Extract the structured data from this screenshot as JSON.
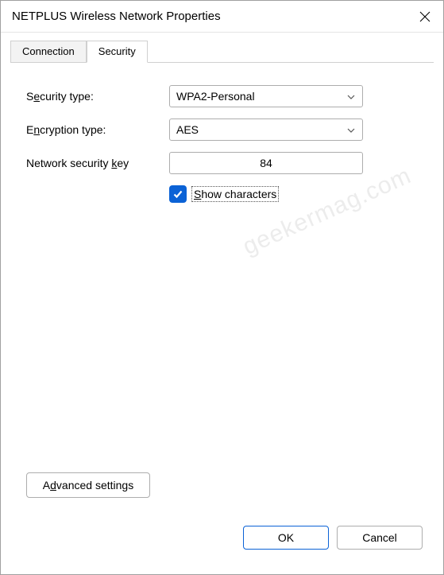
{
  "window": {
    "title": "NETPLUS Wireless Network Properties"
  },
  "tabs": {
    "connection": "Connection",
    "security": "Security"
  },
  "form": {
    "security_type_label_pre": "S",
    "security_type_label_ul": "e",
    "security_type_label_post": "curity type:",
    "security_type_value": "WPA2-Personal",
    "encryption_type_label_pre": "E",
    "encryption_type_label_ul": "n",
    "encryption_type_label_post": "cryption type:",
    "encryption_type_value": "AES",
    "key_label_pre": "Network security ",
    "key_label_ul": "k",
    "key_label_post": "ey",
    "key_value": "84",
    "show_chars_ul": "S",
    "show_chars_rest": "how characters",
    "show_chars_checked": true
  },
  "buttons": {
    "advanced_pre": "A",
    "advanced_ul": "d",
    "advanced_post": "vanced settings",
    "ok": "OK",
    "cancel": "Cancel"
  },
  "watermark": "geekermag.com"
}
